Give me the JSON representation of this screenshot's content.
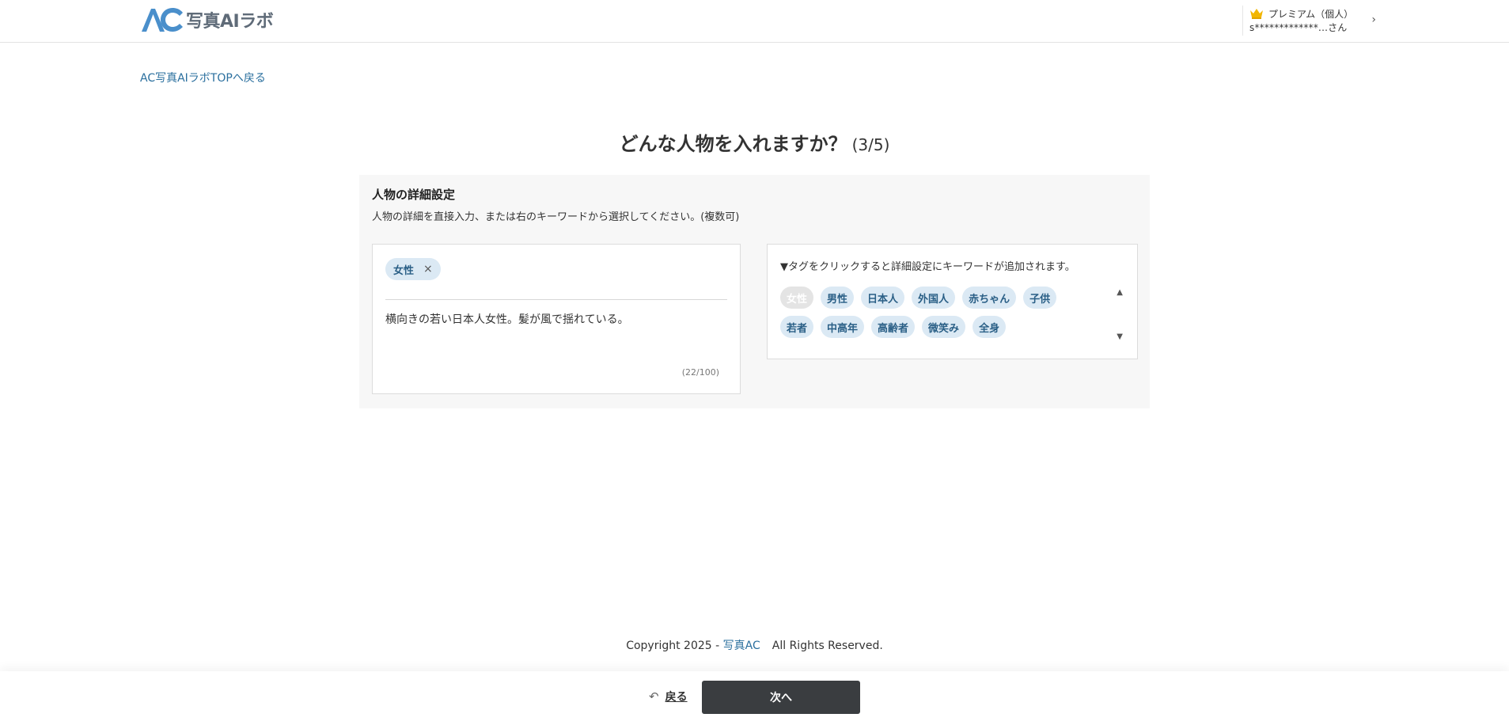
{
  "header": {
    "logo_text": "写真AIラボ",
    "account": {
      "plan": "プレミアム（個人）",
      "name": "s*************...さん"
    }
  },
  "back_top_link": "AC写真AIラボTOPへ戻る",
  "title": "どんな人物を入れますか？",
  "step": "(3/5)",
  "panel": {
    "title": "人物の詳細設定",
    "description": "人物の詳細を直接入力、または右のキーワードから選択してください。(複数可)",
    "selected_tag": "女性",
    "remove_symbol": "×",
    "textarea_value": "横向きの若い日本人女性。髪が風で揺れている。",
    "counter": "(22/100)",
    "tag_hint": "▼タグをクリックすると詳細設定にキーワードが追加されます。",
    "tags_row1": [
      "女性",
      "男性",
      "日本人",
      "外国人",
      "赤ちゃん",
      "子供"
    ],
    "tags_row2": [
      "若者",
      "中高年",
      "高齢者",
      "微笑み",
      "全身"
    ]
  },
  "footer": {
    "copyright_prefix": "Copyright 2025 - ",
    "brand": "写真AC",
    "rights": "All Rights Reserved."
  },
  "bottom": {
    "back_label": "戻る",
    "next_label": "次へ"
  },
  "colors": {
    "link": "#2a6f9e",
    "tag_bg": "#dbe9f4",
    "tag_text": "#2a5f86",
    "next_button": "#3a3d40",
    "logo_blue": "#4a8fcb",
    "crown": "#f2b600"
  },
  "icons": {
    "crown": "crown-icon",
    "chevron": "chevron-right-icon",
    "back": "undo-arrow-icon",
    "scroll_up": "triangle-up-icon",
    "scroll_down": "triangle-down-icon"
  }
}
